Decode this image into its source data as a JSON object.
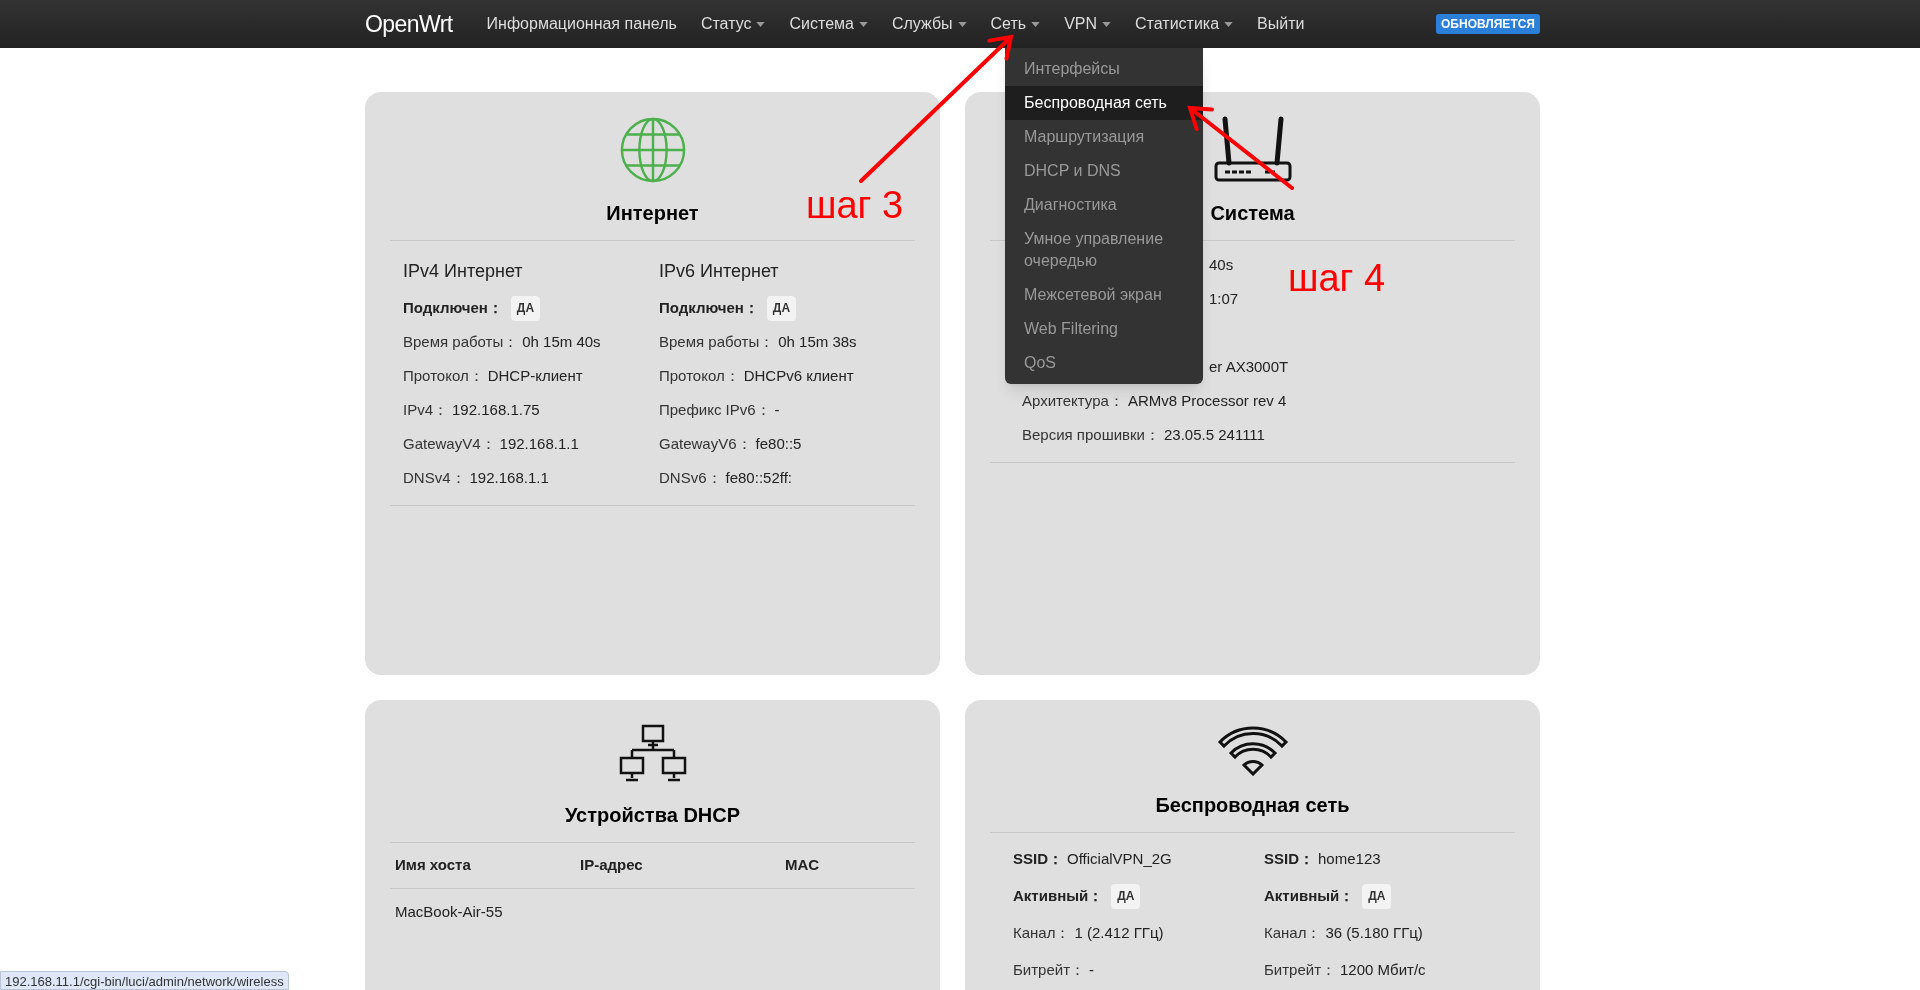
{
  "navbar": {
    "brand": "OpenWrt",
    "items": [
      {
        "label": "Информационная панель",
        "dropdown": false
      },
      {
        "label": "Статус",
        "dropdown": true
      },
      {
        "label": "Система",
        "dropdown": true
      },
      {
        "label": "Службы",
        "dropdown": true
      },
      {
        "label": "Сеть",
        "dropdown": true
      },
      {
        "label": "VPN",
        "dropdown": true
      },
      {
        "label": "Статистика",
        "dropdown": true
      },
      {
        "label": "Выйти",
        "dropdown": false
      }
    ],
    "badge": "ОБНОВЛЯЕТСЯ"
  },
  "network_menu": {
    "items": [
      {
        "label": "Интерфейсы",
        "selected": false
      },
      {
        "label": "Беспроводная сеть",
        "selected": true
      },
      {
        "label": "Маршрутизация",
        "selected": false
      },
      {
        "label": "DHCP и DNS",
        "selected": false
      },
      {
        "label": "Диагностика",
        "selected": false
      },
      {
        "label": "Умное управление очередью",
        "selected": false
      },
      {
        "label": "Межсетевой экран",
        "selected": false
      },
      {
        "label": "Web Filtering",
        "selected": false
      },
      {
        "label": "QoS",
        "selected": false
      }
    ]
  },
  "internet_card": {
    "title": "Интернет",
    "columns": [
      {
        "heading": "IPv4 Интернет",
        "rows": [
          {
            "kind": "badge",
            "label": "Подключен：",
            "value": "ДА"
          },
          {
            "kind": "text",
            "label": "Время работы：",
            "value": "0h 15m 40s"
          },
          {
            "kind": "text",
            "label": "Протокол：",
            "value": "DHCP-клиент"
          },
          {
            "kind": "text",
            "label": "IPv4：",
            "value": "192.168.1.75"
          },
          {
            "kind": "text",
            "label": "GatewayV4：",
            "value": "192.168.1.1"
          },
          {
            "kind": "text",
            "label": "DNSv4：",
            "value": "192.168.1.1"
          }
        ]
      },
      {
        "heading": "IPv6 Интернет",
        "rows": [
          {
            "kind": "badge",
            "label": "Подключен：",
            "value": "ДА"
          },
          {
            "kind": "text",
            "label": "Время работы：",
            "value": "0h 15m 38s"
          },
          {
            "kind": "text",
            "label": "Протокол：",
            "value": "DHCPv6 клиент"
          },
          {
            "kind": "text",
            "label": "Префикс IPv6：",
            "value": "-"
          },
          {
            "kind": "text",
            "label": "GatewayV6：",
            "value": "fe80::5"
          },
          {
            "kind": "text",
            "label": "DNSv6：",
            "value": "fe80::52ff:"
          }
        ]
      }
    ]
  },
  "system_card": {
    "title": "Система",
    "rows": [
      {
        "kind": "fragment",
        "value": "40s"
      },
      {
        "kind": "fragment",
        "value": "1:07"
      },
      {
        "kind": "hidden"
      },
      {
        "kind": "fragment",
        "value": "er AX3000T"
      },
      {
        "kind": "text",
        "label": "Архитектура：",
        "value": "ARMv8 Processor rev 4"
      },
      {
        "kind": "text",
        "label": "Версия прошивки：",
        "value": "23.05.5 241111"
      }
    ]
  },
  "dhcp_card": {
    "title": "Устройства DHCP",
    "columns": [
      "Имя хоста",
      "IP-адрес",
      "MAC"
    ],
    "rows": [
      [
        "MacBook-Air-55"
      ]
    ]
  },
  "wireless_card": {
    "title": "Беспроводная сеть",
    "columns": [
      {
        "rows": [
          {
            "kind": "bold",
            "label": "SSID：",
            "value": "OfficialVPN_2G"
          },
          {
            "kind": "badge",
            "label": "Активный：",
            "value": "ДА"
          },
          {
            "kind": "text",
            "label": "Канал：",
            "value": "1 (2.412 ГГц)"
          },
          {
            "kind": "text",
            "label": "Битрейт：",
            "value": "-"
          }
        ]
      },
      {
        "rows": [
          {
            "kind": "bold",
            "label": "SSID：",
            "value": "home123"
          },
          {
            "kind": "badge",
            "label": "Активный：",
            "value": "ДА"
          },
          {
            "kind": "text",
            "label": "Канал：",
            "value": "36 (5.180 ГГц)"
          },
          {
            "kind": "text",
            "label": "Битрейт：",
            "value": "1200 Мбит/с"
          }
        ]
      }
    ]
  },
  "annotations": [
    {
      "text": "шаг 3"
    },
    {
      "text": "шаг 4"
    }
  ],
  "status_url": "192.168.11.1/cgi-bin/luci/admin/network/wireless"
}
